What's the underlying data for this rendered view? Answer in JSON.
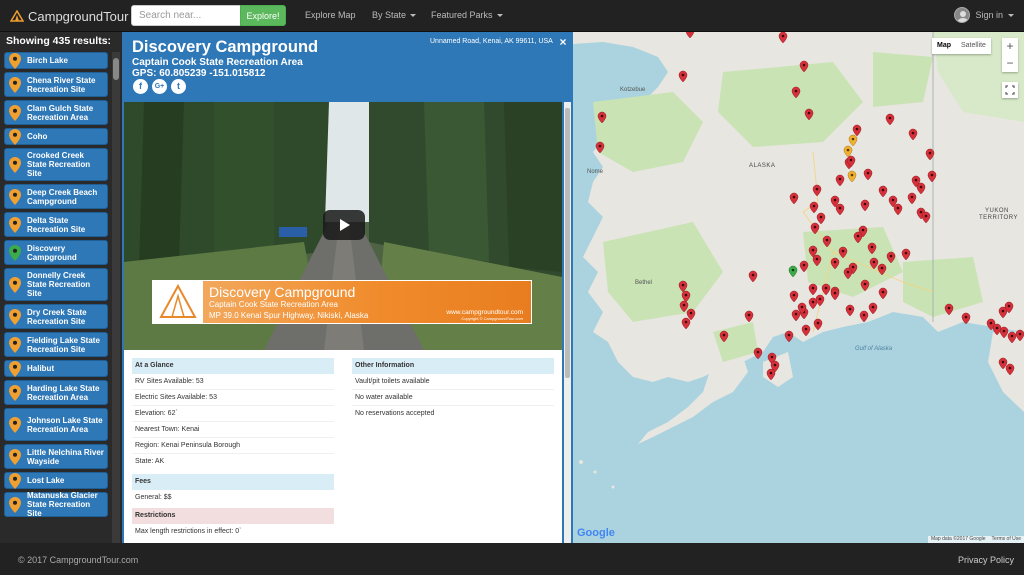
{
  "navbar": {
    "brand": "CampgroundTour",
    "search_placeholder": "Search near...",
    "explore_label": "Explore!",
    "links": [
      "Explore Map",
      "By State",
      "Featured Parks"
    ],
    "signin_label": "Sign in"
  },
  "sidebar": {
    "results_label": "Showing 435 results:",
    "items": [
      {
        "label": "Birch Lake",
        "selected": false
      },
      {
        "label": "Chena River State Recreation Site",
        "selected": false
      },
      {
        "label": "Clam Gulch State Recreation Area",
        "selected": false
      },
      {
        "label": "Coho",
        "selected": false
      },
      {
        "label": "Crooked Creek State Recreation Site",
        "selected": false
      },
      {
        "label": "Deep Creek Beach Campground",
        "selected": false
      },
      {
        "label": "Delta State Recreation Site",
        "selected": false
      },
      {
        "label": "Discovery Campground",
        "selected": true
      },
      {
        "label": "Donnelly Creek State Recreation Site",
        "selected": false
      },
      {
        "label": "Dry Creek State Recreation Site",
        "selected": false
      },
      {
        "label": "Fielding Lake State Recreation Site",
        "selected": false
      },
      {
        "label": "Halibut",
        "selected": false
      },
      {
        "label": "Harding Lake State Recreation Area",
        "selected": false
      },
      {
        "label": "Johnson Lake State Recreation Area",
        "selected": false
      },
      {
        "label": "Little Nelchina River Wayside",
        "selected": false
      },
      {
        "label": "Lost Lake",
        "selected": false
      },
      {
        "label": "Matanuska Glacier State Recreation Site",
        "selected": false
      }
    ]
  },
  "detail": {
    "title": "Discovery Campground",
    "subtitle": "Captain Cook State Recreation Area",
    "gps": "GPS: 60.805239 -151.015812",
    "address": "Unnamed Road, Kenai, AK 99611, USA",
    "close": "×",
    "social": [
      "f",
      "G+",
      "t"
    ],
    "video_banner": {
      "title": "Discovery Campground",
      "subtitle": "Captain Cook State Recreation Area",
      "address": "MP 39.0 Kenai Spur Highway, Nikiski, Alaska",
      "url": "www.campgroundtour.com",
      "copyright": "Copyright © CampgroundTour.com"
    },
    "glance": {
      "heading": "At a Glance",
      "rows": [
        "RV Sites Available: 53",
        "Electric Sites Available: 53",
        "Elevation: 62`",
        "Nearest Town: Kenai",
        "Region: Kenai Peninsula Borough",
        "State: AK"
      ]
    },
    "fees": {
      "heading": "Fees",
      "rows": [
        "General: $$"
      ]
    },
    "restrictions": {
      "heading": "Restrictions",
      "rows": [
        "Max length restrictions in effect: 0`"
      ]
    },
    "other": {
      "heading": "Other Information",
      "rows": [
        "Vault/pit toilets available",
        "No water available",
        "No reservations accepted"
      ]
    }
  },
  "map": {
    "type_map": "Map",
    "type_satellite": "Satellite",
    "zoom_in": "+",
    "zoom_out": "−",
    "labels": {
      "kotzebue": "Kotzebue",
      "nome": "Nome",
      "alaska": "ALASKA",
      "bethel": "Bethel",
      "gulf": "Gulf of Alaska",
      "yukon1": "YUKON",
      "yukon2": "TERRITORY"
    },
    "google": "Google",
    "attribution": "Map data ©2017 Google",
    "terms": "Terms of Use"
  },
  "footer": {
    "copyright": "© 2017 CampgroundTour.com",
    "privacy": "Privacy Policy"
  }
}
